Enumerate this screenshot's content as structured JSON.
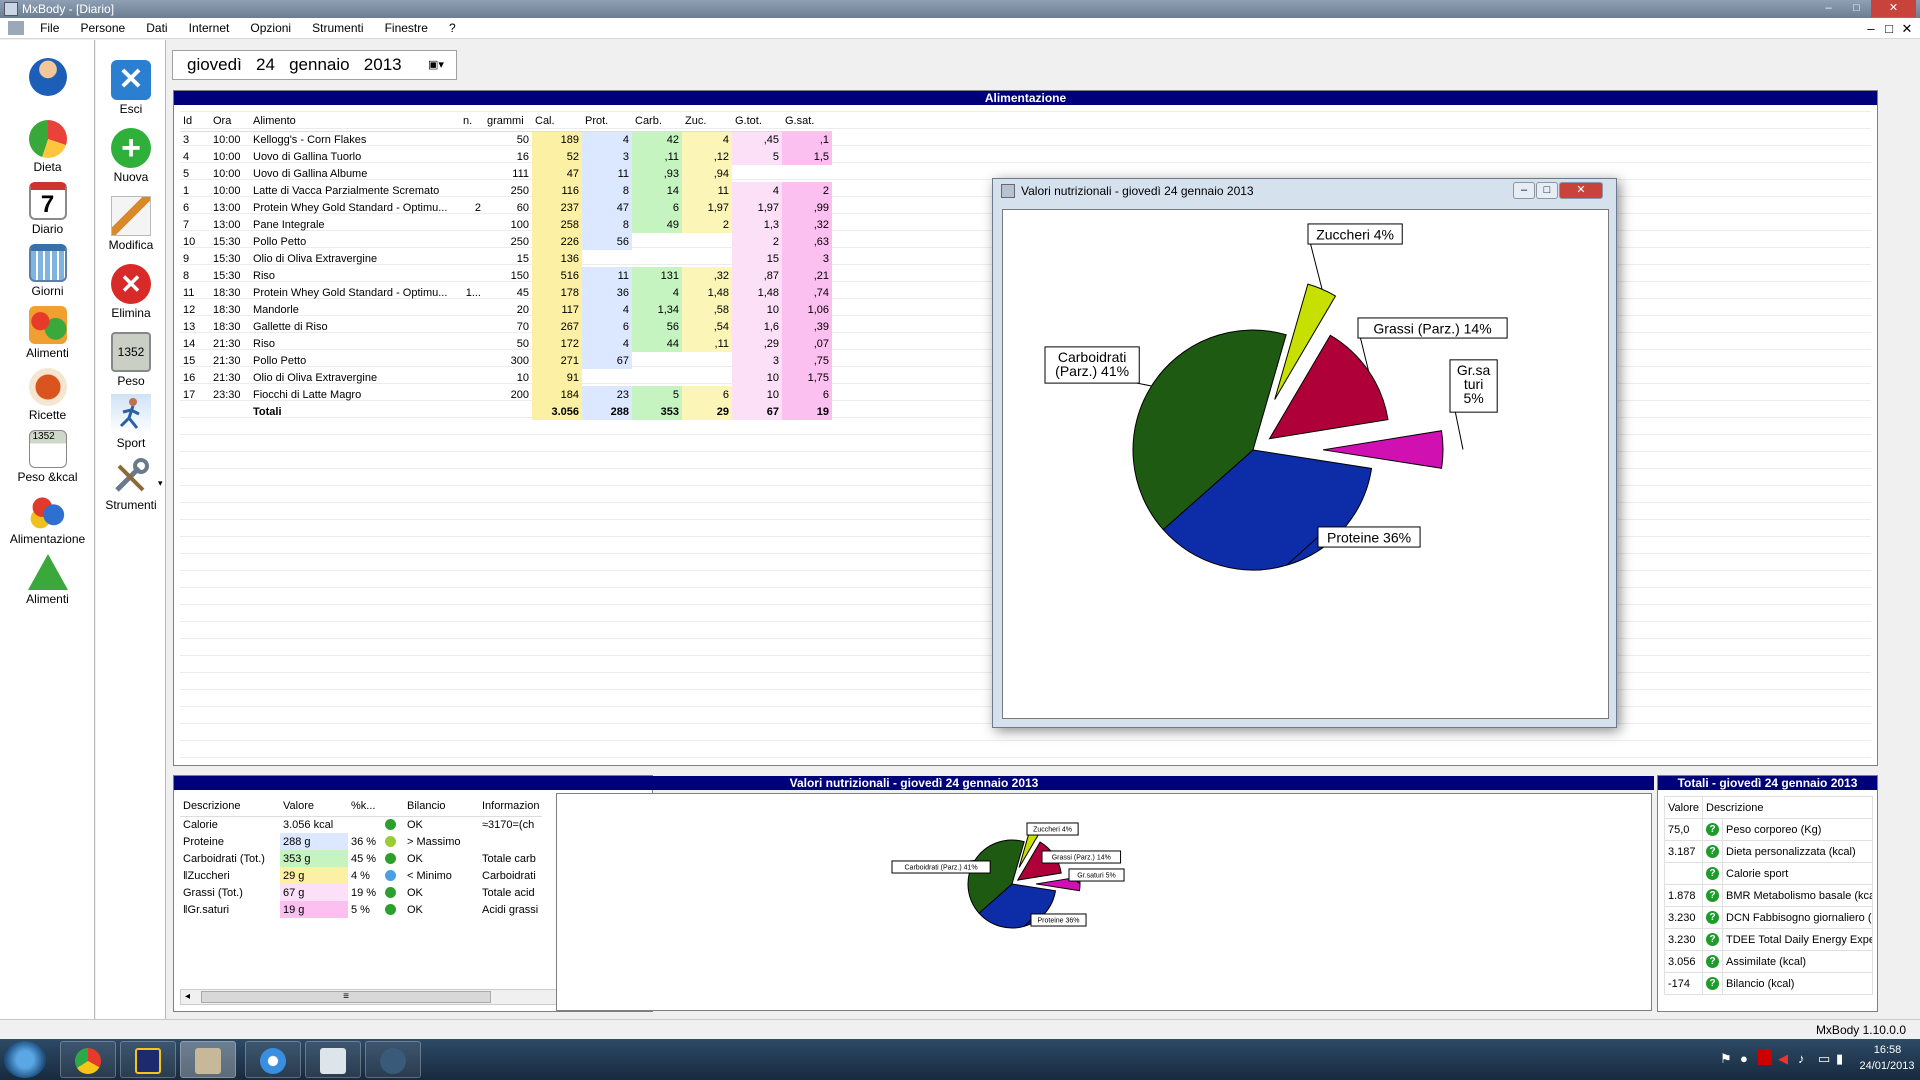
{
  "window": {
    "title": "MxBody - [Diario]",
    "minimize": "–",
    "maximize": "□",
    "close": "✕"
  },
  "menu": {
    "items": [
      "File",
      "Persone",
      "Dati",
      "Internet",
      "Opzioni",
      "Strumenti",
      "Finestre",
      "?"
    ]
  },
  "nav": {
    "items": [
      "Dieta",
      "Diario",
      "Giorni",
      "Alimenti",
      "Ricette",
      "Peso &kcal",
      "Alimentazione",
      "Alimenti"
    ]
  },
  "toolbar": {
    "items": [
      "Esci",
      "Nuova",
      "Modifica",
      "Elimina",
      "Peso",
      "Sport",
      "Strumenti"
    ],
    "peso_display": "1352",
    "peso_kcal_display": "1352"
  },
  "date": {
    "weekday": "giovedì",
    "day": "24",
    "month": "gennaio",
    "year": "2013",
    "calendar_icon": "calendar-icon"
  },
  "alimentazione": {
    "title": "Alimentazione",
    "columns": [
      "Id",
      "Ora",
      "Alimento",
      "n.",
      "grammi",
      "Cal.",
      "Prot.",
      "Carb.",
      "Zuc.",
      "G.tot.",
      "G.sat."
    ],
    "rows": [
      [
        "3",
        "10:00",
        "Kellogg's - Corn Flakes",
        "",
        "50",
        "189",
        "4",
        "42",
        "4",
        ",45",
        ",1"
      ],
      [
        "4",
        "10:00",
        "Uovo di Gallina Tuorlo",
        "",
        "16",
        "52",
        "3",
        ",11",
        ",12",
        "5",
        "1,5"
      ],
      [
        "5",
        "10:00",
        "Uovo di Gallina Albume",
        "",
        "111",
        "47",
        "11",
        ",93",
        ",94",
        "",
        ""
      ],
      [
        "1",
        "10:00",
        "Latte di Vacca Parzialmente Scremato",
        "",
        "250",
        "116",
        "8",
        "14",
        "11",
        "4",
        "2"
      ],
      [
        "6",
        "13:00",
        "Protein Whey Gold Standard - Optimu...",
        "2",
        "60",
        "237",
        "47",
        "6",
        "1,97",
        "1,97",
        ",99"
      ],
      [
        "7",
        "13:00",
        "Pane Integrale",
        "",
        "100",
        "258",
        "8",
        "49",
        "2",
        "1,3",
        ",32"
      ],
      [
        "10",
        "15:30",
        "Pollo Petto",
        "",
        "250",
        "226",
        "56",
        "",
        "",
        "2",
        ",63"
      ],
      [
        "9",
        "15:30",
        "Olio di Oliva Extravergine",
        "",
        "15",
        "136",
        "",
        "",
        "",
        "15",
        "3"
      ],
      [
        "8",
        "15:30",
        "Riso",
        "",
        "150",
        "516",
        "11",
        "131",
        ",32",
        ",87",
        ",21"
      ],
      [
        "11",
        "18:30",
        "Protein Whey Gold Standard - Optimu...",
        "1...",
        "45",
        "178",
        "36",
        "4",
        "1,48",
        "1,48",
        ",74"
      ],
      [
        "12",
        "18:30",
        "Mandorle",
        "",
        "20",
        "117",
        "4",
        "1,34",
        ",58",
        "10",
        "1,06"
      ],
      [
        "13",
        "18:30",
        "Gallette di Riso",
        "",
        "70",
        "267",
        "6",
        "56",
        ",54",
        "1,6",
        ",39"
      ],
      [
        "14",
        "21:30",
        "Riso",
        "",
        "50",
        "172",
        "4",
        "44",
        ",11",
        ",29",
        ",07"
      ],
      [
        "15",
        "21:30",
        "Pollo Petto",
        "",
        "300",
        "271",
        "67",
        "",
        "",
        "3",
        ",75"
      ],
      [
        "16",
        "21:30",
        "Olio di Oliva Extravergine",
        "",
        "10",
        "91",
        "",
        "",
        "",
        "10",
        "1,75"
      ],
      [
        "17",
        "23:30",
        "Fiocchi di Latte Magro",
        "",
        "200",
        "184",
        "23",
        "5",
        "6",
        "10",
        "6"
      ]
    ],
    "totals": [
      "",
      "",
      "Totali",
      "",
      "",
      "3.056",
      "288",
      "353",
      "29",
      "67",
      "19"
    ]
  },
  "popup": {
    "title": "Valori nutrizionali - giovedì 24 gennaio 2013"
  },
  "chart_data": {
    "type": "pie",
    "title": "Valori nutrizionali - giovedì 24 gennaio 2013",
    "slices": [
      {
        "name": "Zuccheri",
        "label": "Zuccheri 4%",
        "value": 4,
        "color": "#c8e000"
      },
      {
        "name": "Grassi (Parz.)",
        "label": "Grassi (Parz.) 14%",
        "value": 14,
        "color": "#b0003a"
      },
      {
        "name": "Gr.saturi",
        "label": "Gr.sa turi 5%",
        "value": 5,
        "color": "#d010b0"
      },
      {
        "name": "Proteine",
        "label": "Proteine 36%",
        "value": 36,
        "color": "#0c2ca8"
      },
      {
        "name": "Carboidrati (Parz.)",
        "label": "Carboidrati (Parz.) 41%",
        "value": 41,
        "color": "#1e5a12"
      }
    ],
    "mini_labels": [
      "Zuccheri 4%",
      "Grassi (Parz.) 14%",
      "Gr.saturi 5%",
      "Proteine 36%",
      "Carboidrati (Parz.) 41%"
    ],
    "popup_labels": {
      "carb": [
        "Carboidrati",
        "(Parz.) 41%"
      ],
      "grsat": [
        "Gr.sa",
        "turi",
        "5%"
      ]
    }
  },
  "valori": {
    "title": "Valori nutrizionali - giovedì 24 gennaio 2013",
    "columns": [
      "Descrizione",
      "Valore",
      "%k...",
      "",
      "Bilancio",
      "Informazion"
    ],
    "rows": [
      {
        "desc": "Calorie",
        "valore": "3.056 kcal",
        "pct": "",
        "status": "OK",
        "info": "≈3170=(ch",
        "color": "#ffffff",
        "dot": "#2ca02c"
      },
      {
        "desc": "Proteine",
        "valore": "288 g",
        "pct": "36 %",
        "status": "> Massimo",
        "info": "",
        "color": "#dce8ff",
        "dot": "#9acd32"
      },
      {
        "desc": "Carboidrati (Tot.)",
        "valore": "353 g",
        "pct": "45 %",
        "status": "OK",
        "info": "Totale carb",
        "color": "#c6f4c0",
        "dot": "#2ca02c"
      },
      {
        "desc": "‖Zuccheri",
        "valore": "29 g",
        "pct": "4 %",
        "status": "< Minimo",
        "info": "Carboidrati",
        "color": "#fbf0a3",
        "dot": "#4aa0e0"
      },
      {
        "desc": "Grassi (Tot.)",
        "valore": "67 g",
        "pct": "19 %",
        "status": "OK",
        "info": "Totale acid",
        "color": "#fbe0f8",
        "dot": "#2ca02c"
      },
      {
        "desc": "‖Gr.saturi",
        "valore": "19 g",
        "pct": "5 %",
        "status": "OK",
        "info": "Acidi grassi",
        "color": "#fcc0f0",
        "dot": "#2ca02c"
      }
    ]
  },
  "totali": {
    "title": "Totali - giovedì 24 gennaio 2013",
    "columns": [
      "Valore",
      "Descrizione"
    ],
    "rows": [
      [
        "75,0",
        "Peso corporeo (Kg)"
      ],
      [
        "3.187",
        "Dieta personalizzata (kcal)"
      ],
      [
        "",
        "Calorie sport"
      ],
      [
        "1.878",
        "BMR Metabolismo basale (kcal)"
      ],
      [
        "3.230",
        "DCN Fabbisogno giornaliero (kcal)"
      ],
      [
        "3.230",
        "TDEE Total Daily Energy Expendit..."
      ],
      [
        "3.056",
        "Assimilate (kcal)"
      ],
      [
        "-174",
        "Bilancio (kcal)"
      ]
    ]
  },
  "statusbar": {
    "version": "MxBody 1.10.0.0"
  },
  "taskbar": {
    "time": "16:58",
    "date": "24/01/2013"
  }
}
